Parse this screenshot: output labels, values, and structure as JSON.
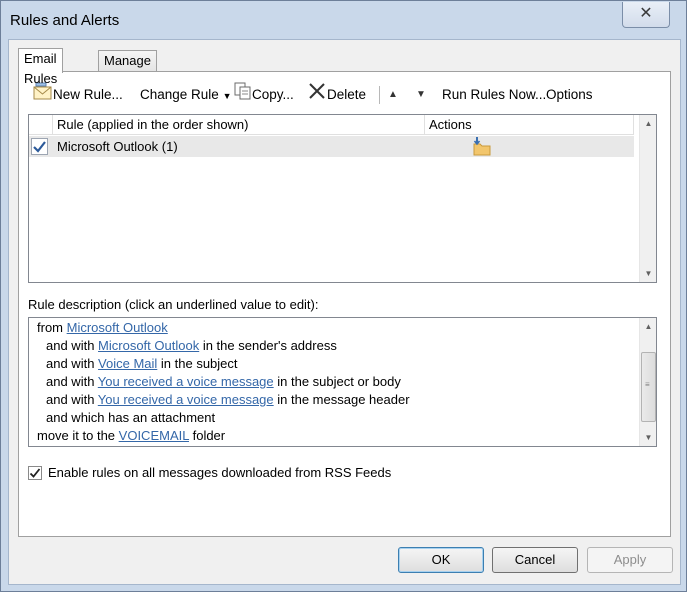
{
  "window": {
    "title": "Rules and Alerts",
    "close_glyph": "✕"
  },
  "tabs": [
    {
      "label": "Email Rules",
      "active": true
    },
    {
      "label": "Manage Alerts",
      "active": false
    }
  ],
  "toolbar": {
    "new_rule": "New Rule...",
    "change_rule": "Change Rule",
    "copy": "Copy...",
    "delete": "Delete",
    "run_rules_now": "Run Rules Now...",
    "options": "Options"
  },
  "rules_grid": {
    "columns": [
      "Rule (applied in the order shown)",
      "Actions"
    ],
    "rows": [
      {
        "name": "Microsoft Outlook (1)",
        "checked": true,
        "action_icon": "move-to-folder-icon"
      }
    ]
  },
  "description": {
    "label": "Rule description (click an underlined value to edit):",
    "lines": [
      {
        "prefix": "from ",
        "link": "Microsoft Outlook",
        "suffix": ""
      },
      {
        "prefix": "and with ",
        "link": "Microsoft Outlook",
        "suffix": " in the sender's address"
      },
      {
        "prefix": "and with ",
        "link": "Voice Mail",
        "suffix": " in the subject"
      },
      {
        "prefix": "and with ",
        "link": "You received a voice message",
        "suffix": " in the subject or body"
      },
      {
        "prefix": "and with ",
        "link": "You received a voice message",
        "suffix": " in the message header"
      },
      {
        "prefix": "and which has an attachment",
        "link": "",
        "suffix": ""
      },
      {
        "prefix": "move it to the ",
        "link": "VOICEMAIL",
        "suffix": " folder"
      }
    ]
  },
  "rss": {
    "label": "Enable rules on all messages downloaded from RSS Feeds",
    "checked": true
  },
  "buttons": {
    "ok": "OK",
    "cancel": "Cancel",
    "apply": "Apply"
  },
  "colors": {
    "link": "#3467a8",
    "frame": "#c9d8ea",
    "selected_row": "#e8e8e8"
  }
}
